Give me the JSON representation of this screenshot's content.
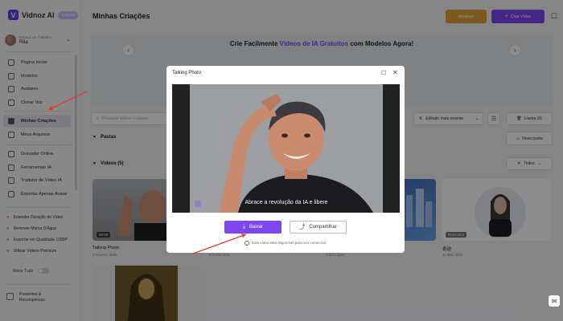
{
  "app": {
    "logo_text": "Vidnoz AI",
    "plan_badge": "Gratuito"
  },
  "workspace": {
    "label": "Espaço de Trabalho",
    "name": "Rita"
  },
  "sidebar": {
    "items": [
      {
        "label": "Página Inicial"
      },
      {
        "label": "Modelos"
      },
      {
        "label": "Avatares"
      },
      {
        "label": "Clonar Voz"
      },
      {
        "label": "Minhas Criações"
      },
      {
        "label": "Meus Arquivos"
      },
      {
        "label": "Gravador Online"
      },
      {
        "label": "Ferramentas IA"
      },
      {
        "label": "Tradutor de Vídeo IA"
      },
      {
        "label": "Exportar Apenas Avatar"
      }
    ],
    "extras": [
      {
        "label": "Estender Duração do Vídeo"
      },
      {
        "label": "Remover Marca D'Água"
      },
      {
        "label": "Exportar em Qualidade 1080P"
      },
      {
        "label": "Utilizar Vídeos Premium"
      }
    ],
    "toggle_label": "Ativar Tudo",
    "gift_label": "Presentes & Recompensas"
  },
  "header": {
    "title": "Minhas Criações",
    "upgrade_label": "Atualizar",
    "create_label": "Criar Vídeo"
  },
  "banner": {
    "text_before": "Crie Facilmente ",
    "text_highlight": "Vídeos de IA Gratuitos",
    "text_after": " com Modelos Agora!"
  },
  "toolbar": {
    "search_placeholder": "Pesquise vídeos e pastas",
    "sort_label": "Editado mais recente",
    "trash_label": "Lixeira (0)",
    "folders_label": "Pastas",
    "new_folder_label": "Nova pasta",
    "videos_label": "Vídeos (5)",
    "filter_label": "Todos"
  },
  "videos": [
    {
      "title": "Talking Photo",
      "time": "2 minutos atrás",
      "duration": "00:08"
    },
    {
      "title": "",
      "time": "6 horas atrás"
    },
    {
      "title": "",
      "time": "3 dias atrás"
    },
    {
      "title": "奇迹",
      "time": "11 dias atrás",
      "tag": "Rascunho"
    }
  ],
  "modal": {
    "title": "Talking Photo",
    "subtitle": "Abrace a revolução da IA e libere",
    "download_label": "Baixar",
    "share_label": "Compartilhar",
    "notice": "Este vídeo está disponível para uso comercial."
  },
  "colors": {
    "accent": "#7d46f2",
    "upgrade": "#e4a23a",
    "annotation": "#e8382b"
  }
}
